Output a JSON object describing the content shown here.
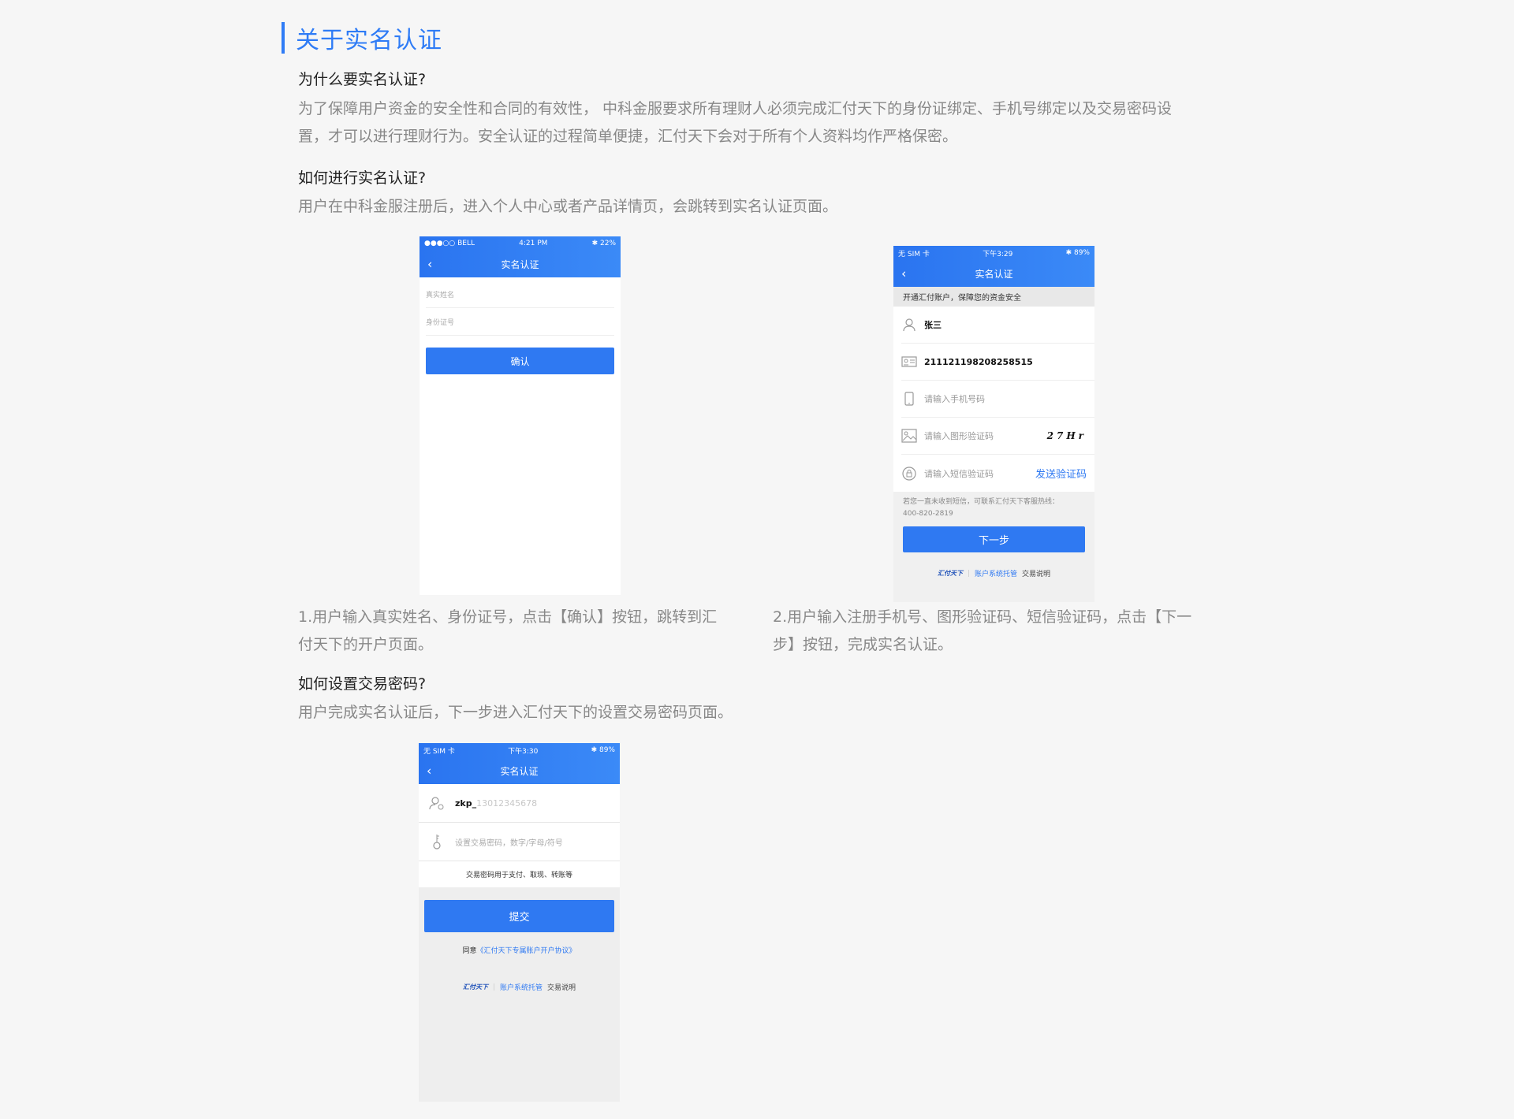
{
  "section_title": "关于实名认证",
  "q1": "为什么要实名认证?",
  "p1_line1": "为了保障用户资金的安全性和合同的有效性， 中科金服要求所有理财人必须完成汇付天下的身份证绑定、手机号绑定以及交易密码设",
  "p1_line2": "置，才可以进行理财行为。安全认证的过程简单便捷，汇付天下会对于所有个人资料均作严格保密。",
  "q2": "如何进行实名认证?",
  "p2": "用户在中科金服注册后，进入个人中心或者产品详情页，会跳转到实名认证页面。",
  "caption1_line1": "1.用户输入真实姓名、身份证号，点击【确认】按钮，跳转到汇",
  "caption1_line2": "付天下的开户页面。",
  "caption2_line1": "2.用户输入注册手机号、图形验证码、短信验证码，点击【下一",
  "caption2_line2": "步】按钮，完成实名认证。",
  "q3": "如何设置交易密码?",
  "p3": "用户完成实名认证后，下一步进入汇付天下的设置交易密码页面。",
  "phone1": {
    "status_left": "●●●○○ BELL ",
    "status_time": "4:21 PM",
    "status_right": "✱ 22%",
    "nav_title": "实名认证",
    "name_placeholder": "真实姓名",
    "id_placeholder": "身份证号",
    "confirm_label": "确认"
  },
  "phone2": {
    "status_left": "无 SIM 卡",
    "status_time": "下午3:29",
    "status_right": "✱ 89%",
    "nav_title": "实名认证",
    "notice": "开通汇付账户，保障您的资金安全",
    "name_value": "张三",
    "id_value": "211121198208258515",
    "phone_placeholder": "请输入手机号码",
    "captcha_placeholder": "请输入图形验证码",
    "captcha_text": "27Hr",
    "sms_placeholder": "请输入短信验证码",
    "send_code": "发送验证码",
    "hint_line1": "若您一直未收到短信，可联系汇付天下客服热线：",
    "hint_line2": "400-820-2819",
    "next_label": "下一步",
    "footer_logo": "汇付天下",
    "footer_link": "账户系统托管",
    "footer_text": "交易说明"
  },
  "phone3": {
    "status_left": "无 SIM 卡",
    "status_time": "下午3:30",
    "status_right": "✱ 89%",
    "nav_title": "实名认证",
    "user_name": "zkp_",
    "user_phone": "13012345678",
    "password_placeholder": "设置交易密码，数字/字母/符号",
    "password_note": "交易密码用于支付、取现、转账等",
    "submit_label": "提交",
    "agree_prefix": "同意",
    "agree_link": "《汇付天下专属账户开户协议》",
    "footer_logo": "汇付天下",
    "footer_link": "账户系统托管",
    "footer_text": "交易说明"
  }
}
